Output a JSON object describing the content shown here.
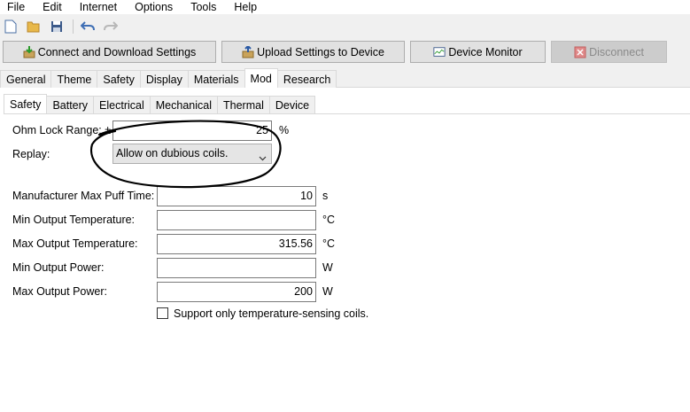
{
  "menu": [
    "File",
    "Edit",
    "Internet",
    "Options",
    "Tools",
    "Help"
  ],
  "toolbar": {
    "icons": [
      "new-file-icon",
      "open-folder-icon",
      "save-icon",
      "undo-icon",
      "redo-icon"
    ]
  },
  "buttons": {
    "connect": "Connect and Download Settings",
    "upload": "Upload Settings to Device",
    "monitor": "Device Monitor",
    "disconnect": "Disconnect"
  },
  "main_tabs": [
    "General",
    "Theme",
    "Safety",
    "Display",
    "Materials",
    "Mod",
    "Research"
  ],
  "main_tabs_active": "Mod",
  "sub_tabs": [
    "Safety",
    "Battery",
    "Electrical",
    "Mechanical",
    "Thermal",
    "Device"
  ],
  "sub_tabs_active": "Safety",
  "form": {
    "ohm_lock_label": "Ohm Lock Range: ±",
    "ohm_lock_value": "25",
    "ohm_lock_unit": "%",
    "replay_label": "Replay:",
    "replay_value": "Allow on dubious coils.",
    "max_puff_label": "Manufacturer Max Puff Time:",
    "max_puff_value": "10",
    "max_puff_unit": "s",
    "min_temp_label": "Min Output Temperature:",
    "min_temp_value": "",
    "min_temp_unit": "°C",
    "max_temp_label": "Max Output Temperature:",
    "max_temp_value": "315.56",
    "max_temp_unit": "°C",
    "min_power_label": "Min Output Power:",
    "min_power_value": "",
    "min_power_unit": "W",
    "max_power_label": "Max Output Power:",
    "max_power_value": "200",
    "max_power_unit": "W",
    "temp_sensing_label": "Support only temperature-sensing coils."
  }
}
